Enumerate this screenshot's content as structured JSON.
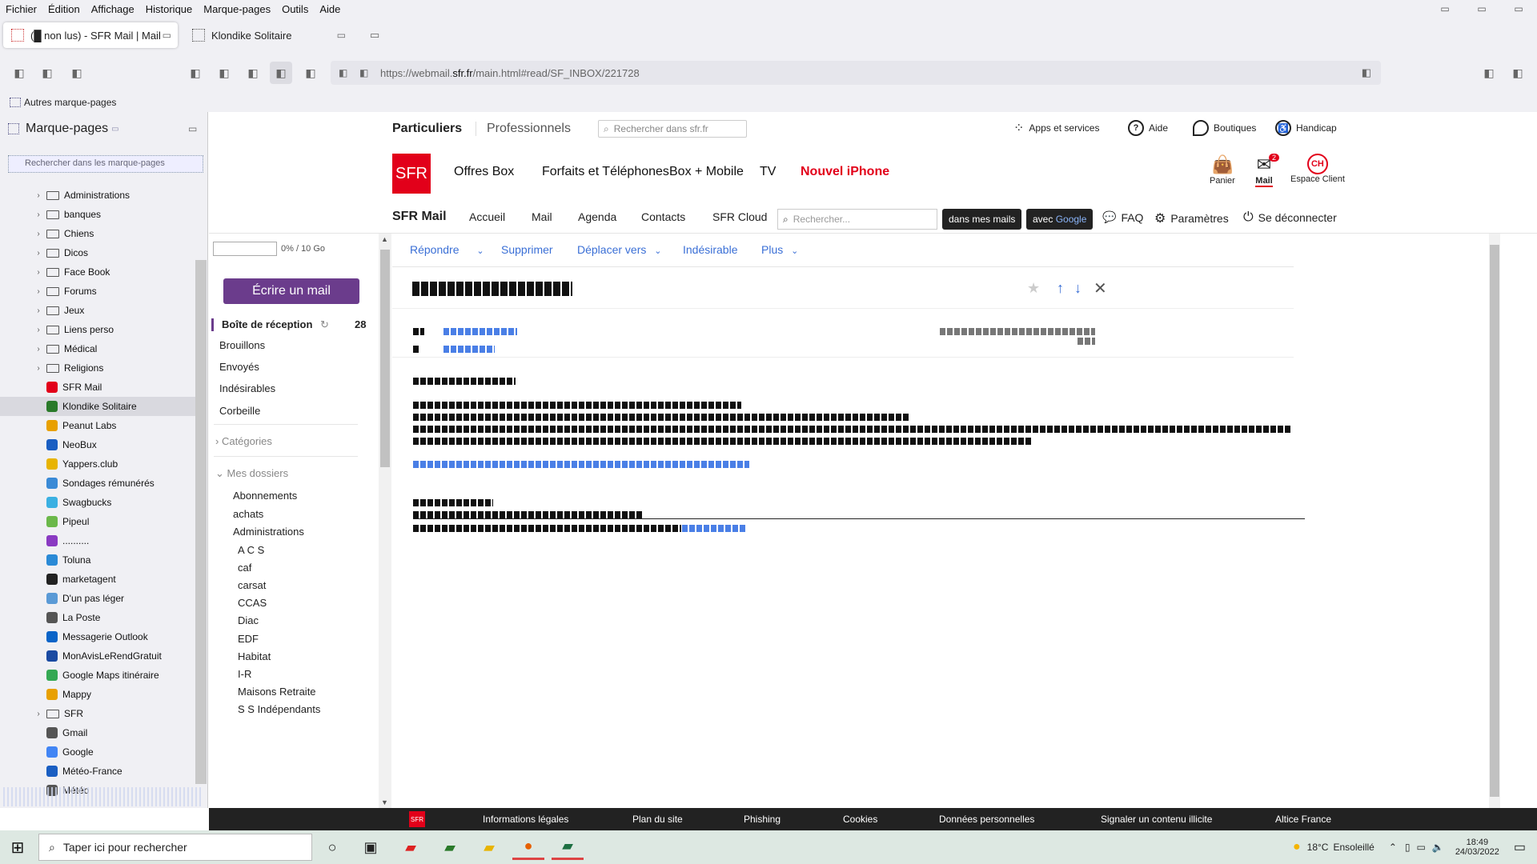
{
  "menu": [
    "Fichier",
    "Édition",
    "Affichage",
    "Historique",
    "Marque-pages",
    "Outils",
    "Aide"
  ],
  "tabs": [
    {
      "label": "(█ non lus) - SFR Mail | Mail"
    },
    {
      "label": "Klondike Solitaire"
    }
  ],
  "url": {
    "prefix": "https://webmail.",
    "host": "sfr.fr",
    "path": "/main.html#read/SF_INBOX/221728"
  },
  "bookmarks_toolbar": "Autres marque-pages",
  "sidebar": {
    "title": "Marque-pages",
    "search_placeholder": "Rechercher dans les marque-pages",
    "items": [
      {
        "label": "Administrations",
        "folder": true
      },
      {
        "label": "banques",
        "folder": true
      },
      {
        "label": "Chiens",
        "folder": true
      },
      {
        "label": "Dicos",
        "folder": true
      },
      {
        "label": "Face Book",
        "folder": true
      },
      {
        "label": "Forums",
        "folder": true
      },
      {
        "label": "Jeux",
        "folder": true
      },
      {
        "label": "Liens perso",
        "folder": true
      },
      {
        "label": "Médical",
        "folder": true
      },
      {
        "label": "Religions",
        "folder": true
      },
      {
        "label": "SFR Mail",
        "folder": false,
        "color": "#e2001a"
      },
      {
        "label": "Klondike Solitaire",
        "folder": false,
        "color": "#2a7a2a",
        "selected": true
      },
      {
        "label": "Peanut Labs",
        "folder": false,
        "color": "#e8a000"
      },
      {
        "label": "NeoBux",
        "folder": false,
        "color": "#1a5ec2"
      },
      {
        "label": "Yappers.club",
        "folder": false,
        "color": "#e8b400"
      },
      {
        "label": "Sondages rémunérés",
        "folder": false,
        "color": "#3a8ad6"
      },
      {
        "label": "Swagbucks",
        "folder": false,
        "color": "#3ab0e2"
      },
      {
        "label": "Pipeul",
        "folder": false,
        "color": "#6bb84a"
      },
      {
        "label": "..........",
        "folder": false,
        "color": "#8a3ac2"
      },
      {
        "label": "Toluna",
        "folder": false,
        "color": "#2a8ad6"
      },
      {
        "label": "marketagent",
        "folder": false,
        "color": "#222"
      },
      {
        "label": "D'un pas léger",
        "folder": false,
        "color": "#5a9ad6"
      },
      {
        "label": "La Poste",
        "folder": false,
        "color": "#555"
      },
      {
        "label": "Messagerie Outlook",
        "folder": false,
        "color": "#0a64c8"
      },
      {
        "label": "MonAvisLeRendGratuit",
        "folder": false,
        "color": "#1a4aa2"
      },
      {
        "label": "Google Maps itinéraire",
        "folder": false,
        "color": "#34a853"
      },
      {
        "label": "Mappy",
        "folder": false,
        "color": "#e8a000"
      },
      {
        "label": "SFR",
        "folder": true
      },
      {
        "label": "Gmail",
        "folder": false,
        "color": "#555"
      },
      {
        "label": "Google",
        "folder": false,
        "color": "#4285f4"
      },
      {
        "label": "Météo-France",
        "folder": false,
        "color": "#1a5ec2"
      },
      {
        "label": "Météo",
        "folder": false,
        "color": "#555"
      }
    ]
  },
  "sfr": {
    "top": {
      "particuliers": "Particuliers",
      "professionnels": "Professionnels",
      "search_placeholder": "Rechercher dans sfr.fr",
      "apps": "Apps et services",
      "aide": "Aide",
      "boutiques": "Boutiques",
      "handicap": "Handicap"
    },
    "logo": "SFR",
    "nav": [
      "Offres Box",
      "Forfaits et Téléphones",
      "Box + Mobile",
      "TV"
    ],
    "nav_highlight": "Nouvel iPhone",
    "right": {
      "panier": "Panier",
      "mail": "Mail",
      "mail_badge": "2",
      "espace": "Espace Client",
      "ch": "CH"
    },
    "subnav": {
      "brand": "SFR Mail",
      "items": [
        "Accueil",
        "Mail",
        "Agenda",
        "Contacts",
        "SFR Cloud"
      ],
      "search_placeholder": "Rechercher...",
      "btn_mails": "dans mes mails",
      "btn_google_prefix": "avec",
      "btn_google": "Google",
      "faq": "FAQ",
      "params": "Paramètres",
      "logout": "Se déconnecter"
    }
  },
  "mail": {
    "quota": "0% / 10 Go",
    "compose": "Écrire un mail",
    "inbox": "Boîte de réception",
    "inbox_count": "28",
    "folders": [
      "Brouillons",
      "Envoyés",
      "Indésirables",
      "Corbeille"
    ],
    "categories": "Catégories",
    "my_folders": "Mes dossiers",
    "user_folders": [
      "Abonnements",
      "achats",
      "Administrations"
    ],
    "sub_folders": [
      "A C S",
      "caf",
      "carsat",
      "CCAS",
      "Diac",
      "EDF",
      "Habitat",
      "I-R",
      "Maisons Retraite",
      "S S Indépendants"
    ],
    "actions": [
      "Répondre",
      "Supprimer",
      "Déplacer vers",
      "Indésirable",
      "Plus"
    ]
  },
  "footer": {
    "logo": "SFR",
    "links": [
      "Informations légales",
      "Plan du site",
      "Phishing",
      "Cookies",
      "Données personnelles",
      "Signaler un contenu illicite",
      "Altice France"
    ]
  },
  "taskbar": {
    "search": "Taper ici pour rechercher",
    "weather": "18°C",
    "weather_desc": "Ensoleillé",
    "time": "18:49",
    "date": "24/03/2022"
  },
  "colors": {
    "sfr_red": "#e2001a",
    "purple": "#6b3c8c",
    "link_blue": "#3a6fd6"
  }
}
